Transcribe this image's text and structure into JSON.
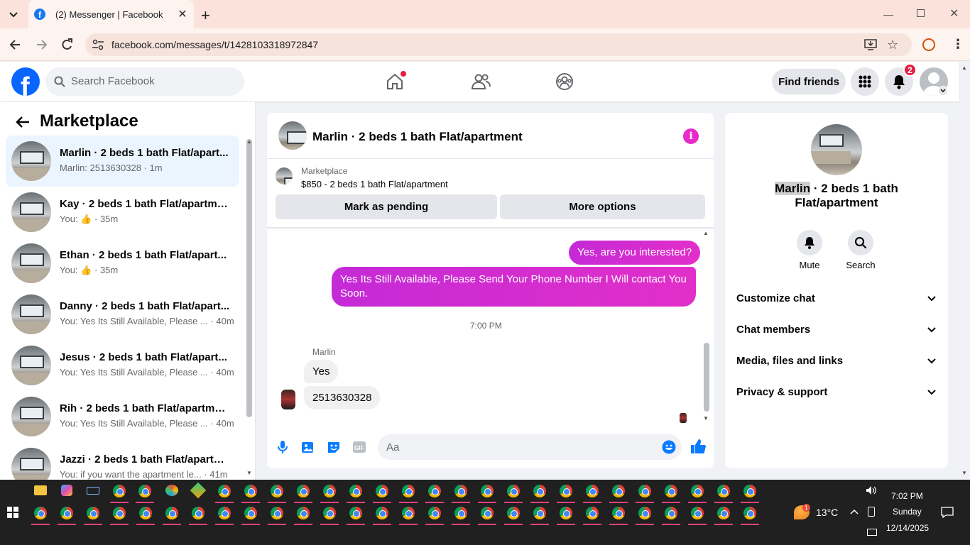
{
  "browser": {
    "tab_title": "(2) Messenger | Facebook",
    "url": "facebook.com/messages/t/1428103318972847"
  },
  "fb_header": {
    "search_placeholder": "Search Facebook",
    "find_friends": "Find friends",
    "notification_count": "2"
  },
  "sidebar": {
    "title": "Marketplace",
    "conversations": [
      {
        "name": "Marlin · 2 beds 1 bath Flat/apart...",
        "preview": "Marlin: 2513630328 · 1m",
        "active": true
      },
      {
        "name": "Kay · 2 beds 1 bath Flat/apartment",
        "preview_prefix": "You:",
        "preview_suffix": "· 35m",
        "like": true
      },
      {
        "name": "Ethan · 2 beds 1 bath Flat/apart...",
        "preview_prefix": "You:",
        "preview_suffix": "· 35m",
        "like": true
      },
      {
        "name": "Danny · 2 beds 1 bath Flat/apart...",
        "preview": "You: Yes Its Still Available, Please ... · 40m"
      },
      {
        "name": "Jesus · 2 beds 1 bath Flat/apart...",
        "preview": "You: Yes Its Still Available, Please ... · 40m"
      },
      {
        "name": "Rih · 2 beds 1 bath Flat/apartment",
        "preview": "You: Yes Its Still Available, Please ... · 40m"
      },
      {
        "name": "Jazzi · 2 beds 1 bath Flat/apartm...",
        "preview": "You: if you want the apartment le... · 41m"
      }
    ]
  },
  "chat": {
    "header_name": "Marlin · 2 beds 1 bath Flat/apartment",
    "listing_source": "Marketplace",
    "listing_title": "$850 - 2 beds 1 bath Flat/apartment",
    "btn_pending": "Mark as pending",
    "btn_more": "More options",
    "messages": {
      "me1": "Yes, are you interested?",
      "me2": "Yes Its Still Available, Please Send Your Phone Number I Will contact You Soon.",
      "timestamp": "7:00 PM",
      "sender": "Marlin",
      "them1": "Yes",
      "them2": "2513630328"
    },
    "composer_placeholder": "Aa"
  },
  "details": {
    "name_highlight": "Marlin",
    "name_rest": " · 2 beds 1 bath Flat/apartment",
    "mute": "Mute",
    "search": "Search",
    "sections": [
      "Customize chat",
      "Chat members",
      "Media, files and links",
      "Privacy & support"
    ]
  },
  "taskbar": {
    "weather_temp": "13°C",
    "time": "7:02 PM",
    "day": "Sunday",
    "date": "12/14/2025",
    "weather_badge": "1"
  }
}
